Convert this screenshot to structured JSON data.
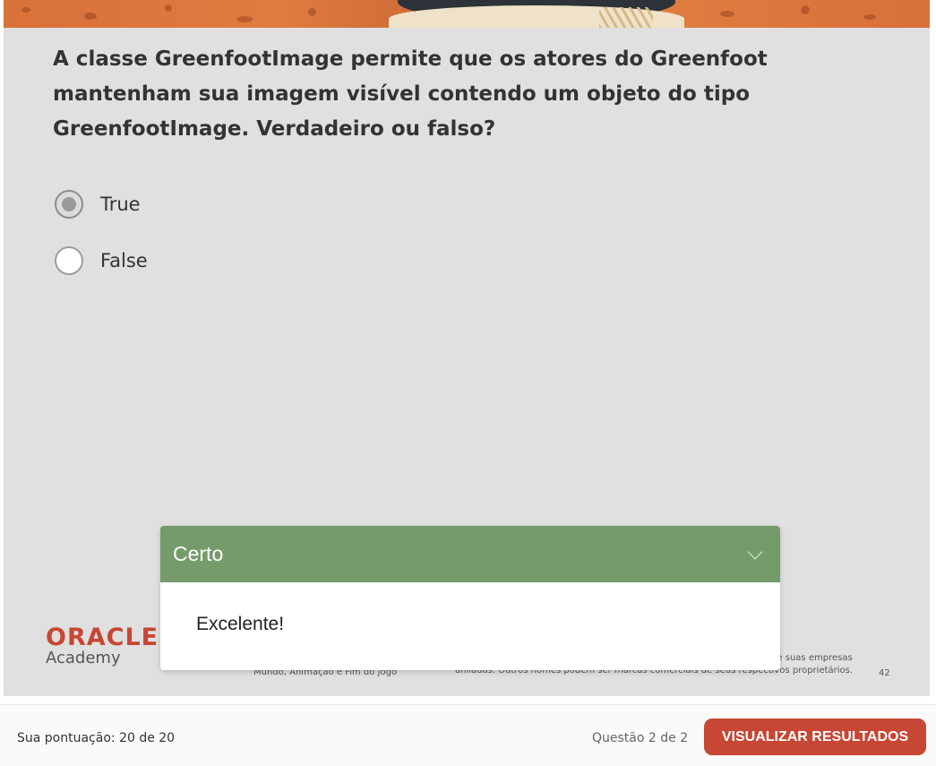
{
  "question": {
    "text": "A classe GreenfootImage permite que os atores do Greenfoot mantenham sua imagem visível contendo um objeto do tipo GreenfootImage. Verdadeiro ou falso?"
  },
  "options": [
    {
      "label": "True",
      "selected": true
    },
    {
      "label": "False",
      "selected": false
    }
  ],
  "slide_footer": {
    "logo_brand": "ORACLE",
    "logo_sub": "Academy",
    "lesson": "Mundo, Animação e Fim do Jogo",
    "copyright": "MySQL são marcas comerciais registradas da Oracle Corporation e/ou de suas empresas afiliadas. Outros nomes podem ser marcas comerciais de seus respectivos proprietários.",
    "page_number": "42"
  },
  "feedback": {
    "title": "Certo",
    "message": "Excelente!",
    "header_color": "#759b6b"
  },
  "bottom_bar": {
    "score": "Sua pontuação: 20 de 20",
    "question_count": "Questão 2 de 2",
    "results_button": "VISUALIZAR RESULTADOS",
    "button_color": "#c74634"
  }
}
